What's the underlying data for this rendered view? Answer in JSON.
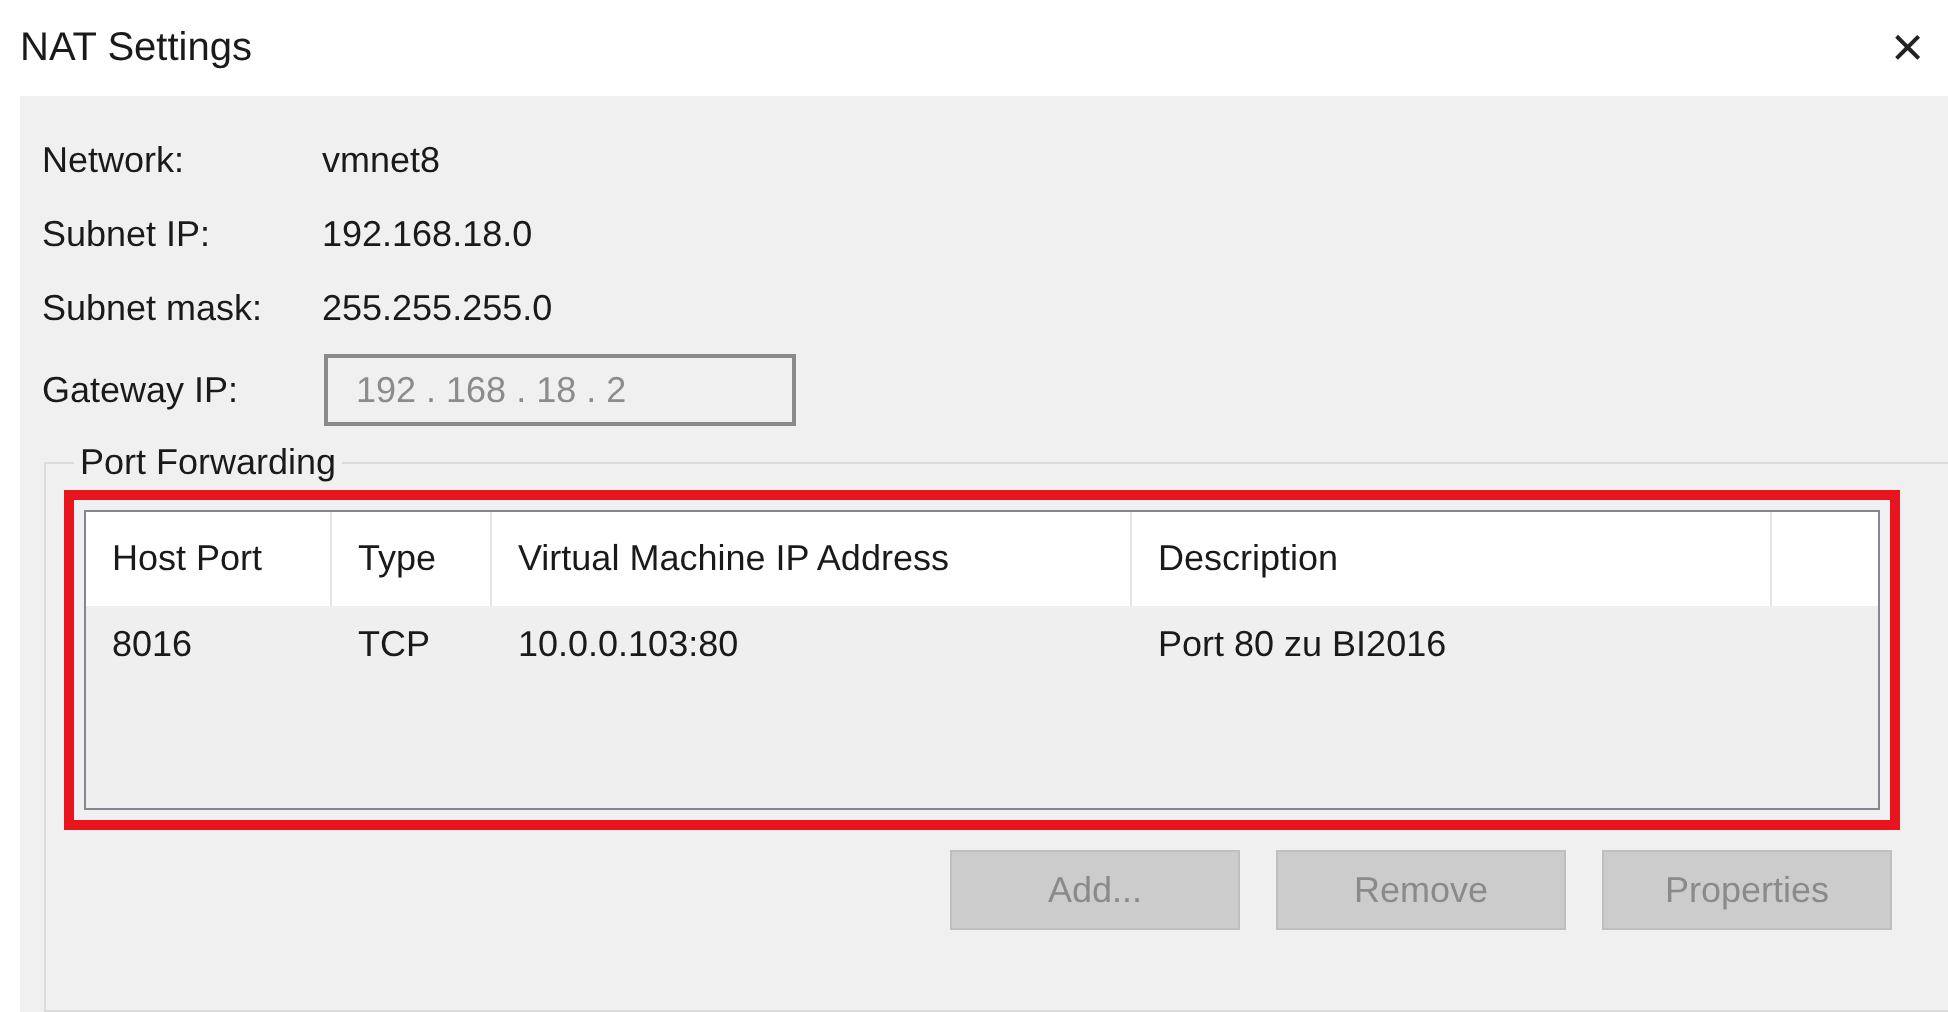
{
  "window": {
    "title": "NAT Settings",
    "close": "×"
  },
  "info": [
    {
      "label": "Network:",
      "value": "vmnet8"
    },
    {
      "label": "Subnet IP:",
      "value": "192.168.18.0"
    },
    {
      "label": "Subnet mask:",
      "value": "255.255.255.0"
    }
  ],
  "gateway": {
    "label": "Gateway IP:",
    "value": "192 . 168 . 18 . 2",
    "disabled": true
  },
  "port_forwarding": {
    "title": "Port Forwarding",
    "highlighted": true,
    "columns": [
      "Host Port",
      "Type",
      "Virtual Machine IP Address",
      "Description"
    ],
    "rows": [
      [
        "8016",
        "TCP",
        "10.0.0.103:80",
        "Port 80 zu BI2016"
      ]
    ]
  },
  "buttons": [
    {
      "label": "Add...",
      "disabled": true
    },
    {
      "label": "Remove",
      "disabled": true
    },
    {
      "label": "Properties",
      "disabled": true
    }
  ]
}
